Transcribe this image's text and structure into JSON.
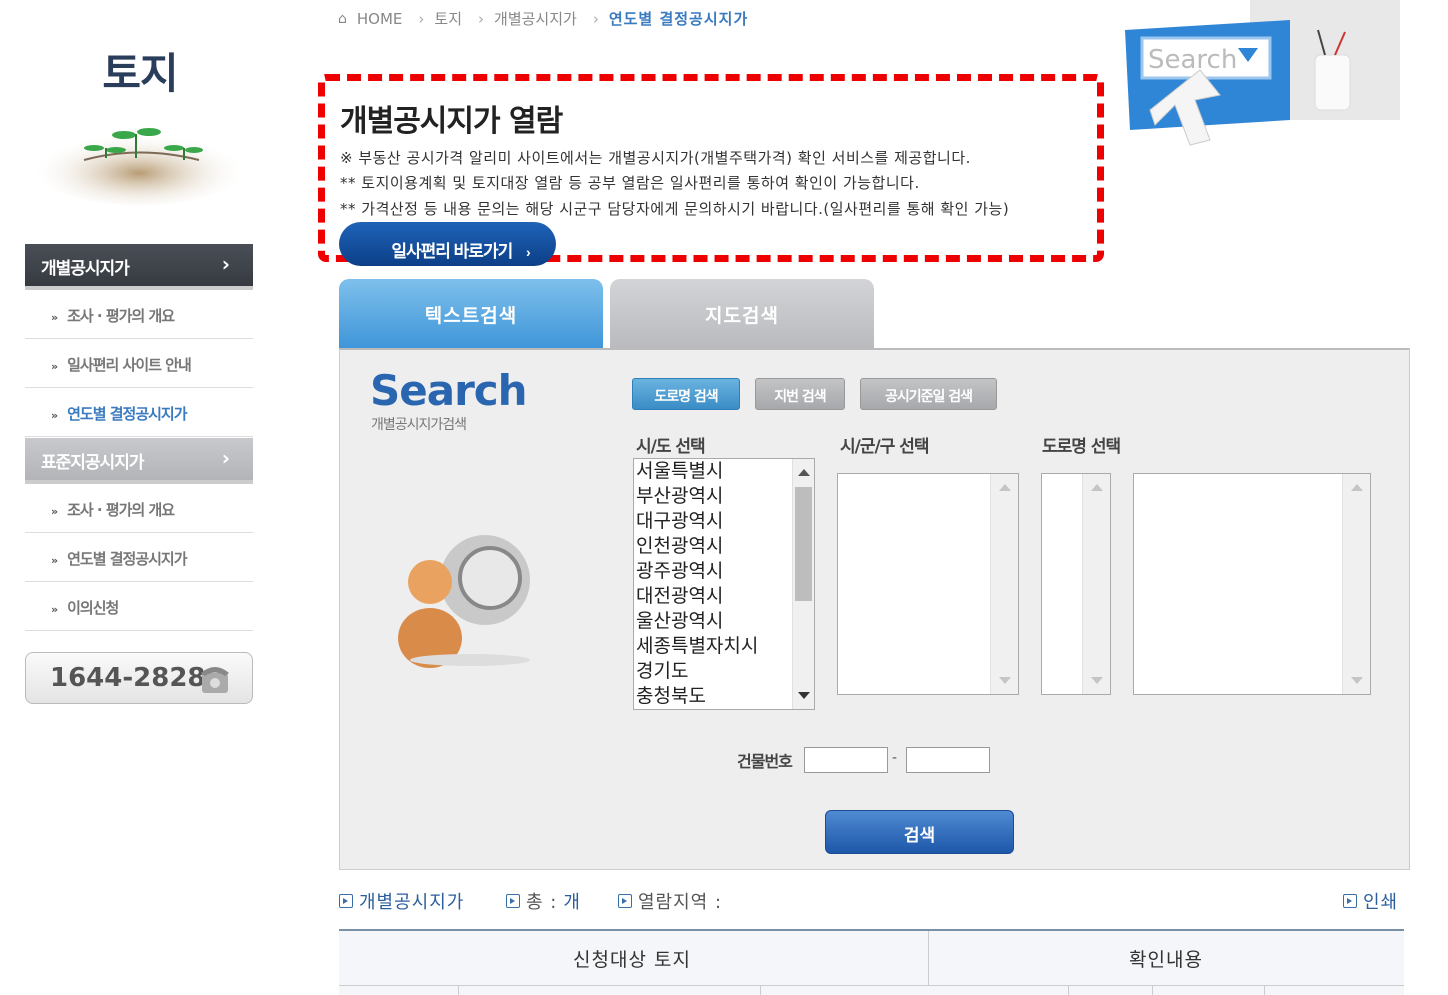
{
  "sidebar": {
    "title": "토지",
    "group1_label": "개별공시지가",
    "group1_items": [
      "조사 · 평가의 개요",
      "일사편리 사이트 안내",
      "연도별 결정공시지가"
    ],
    "group2_label": "표준지공시지가",
    "group2_items": [
      "조사 · 평가의 개요",
      "연도별 결정공시지가",
      "이의신청"
    ],
    "phone": "1644-2828"
  },
  "breadcrumb": {
    "home": "HOME",
    "level1": "토지",
    "level2": "개별공시지가",
    "current": "연도별 결정공시지가"
  },
  "intro": {
    "title": "개별공시지가 열람",
    "lines": [
      "※ 부동산 공시가격 알리미 사이트에서는 개별공시지가(개별주택가격) 확인 서비스를 제공합니다.",
      "** 토지이용계획 및 토지대장 열람 등 공부 열람은 일사편리를 통하여 확인이 가능합니다.",
      "** 가격산정 등 내용 문의는 해당 시군구 담당자에게 문의하시기 바랍니다.(일사편리를 통해 확인 가능)"
    ],
    "button": "일사편리 바로가기",
    "deco_text": "Search"
  },
  "tabs": {
    "text_search": "텍스트검색",
    "map_search": "지도검색"
  },
  "search_panel": {
    "logo": "Search",
    "logo_sub": "개별공시지가검색",
    "subtabs": [
      "도로명 검색",
      "지번 검색",
      "공시기준일 검색"
    ],
    "sido_label": "시/도 선택",
    "sigungu_label": "시/군/구 선택",
    "road_label": "도로명 선택",
    "sido_options": [
      "서울특별시",
      "부산광역시",
      "대구광역시",
      "인천광역시",
      "광주광역시",
      "대전광역시",
      "울산광역시",
      "세종특별자치시",
      "경기도",
      "충청북도"
    ],
    "building_label": "건물번호",
    "building_sep": "-",
    "building_value1": "",
    "building_value2": "",
    "search_button": "검색"
  },
  "info_bar": {
    "item1": "개별공시지가",
    "total_label": "총 :",
    "total_unit": "개",
    "region_label": "열람지역 :",
    "print": "인쇄"
  },
  "table": {
    "col1": "신청대상 토지",
    "col2": "확인내용"
  },
  "colors": {
    "accent_blue": "#3a7bc0",
    "dash_red": "#ee0000",
    "button_navy": "#0c3f87"
  }
}
